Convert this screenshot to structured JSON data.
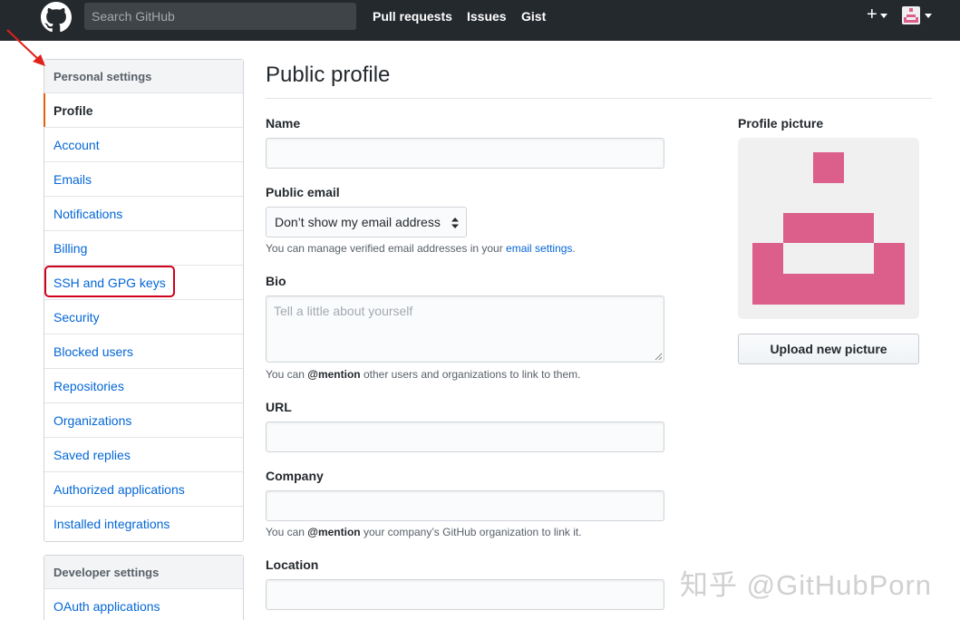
{
  "header": {
    "search_placeholder": "Search GitHub",
    "nav": [
      "Pull requests",
      "Issues",
      "Gist"
    ],
    "plus_label": "+",
    "icons": [
      "github-logo",
      "plus-icon",
      "avatar"
    ]
  },
  "sidebar": {
    "personal": {
      "heading": "Personal settings",
      "items": [
        "Profile",
        "Account",
        "Emails",
        "Notifications",
        "Billing",
        "SSH and GPG keys",
        "Security",
        "Blocked users",
        "Repositories",
        "Organizations",
        "Saved replies",
        "Authorized applications",
        "Installed integrations"
      ],
      "selected": "Profile"
    },
    "developer": {
      "heading": "Developer settings",
      "items": [
        "OAuth applications"
      ]
    }
  },
  "main": {
    "title": "Public profile",
    "name_label": "Name",
    "email_label": "Public email",
    "email_select": "Don’t show my email address",
    "email_note_prefix": "You can manage verified email addresses in your ",
    "email_note_link": "email settings",
    "email_note_suffix": ".",
    "bio_label": "Bio",
    "bio_placeholder": "Tell a little about yourself",
    "bio_note_prefix": "You can ",
    "bio_note_mention": "@mention",
    "bio_note_suffix": " other users and organizations to link to them.",
    "url_label": "URL",
    "company_label": "Company",
    "company_note_prefix": "You can ",
    "company_note_mention": "@mention",
    "company_note_suffix": " your company’s GitHub organization to link it.",
    "location_label": "Location"
  },
  "profile_picture": {
    "label": "Profile picture",
    "upload_label": "Upload new picture",
    "identicon_color": "#db5f8a"
  },
  "annotations": {
    "highlight_color": "#d0021b",
    "watermark": "知乎 @GitHubPorn"
  }
}
